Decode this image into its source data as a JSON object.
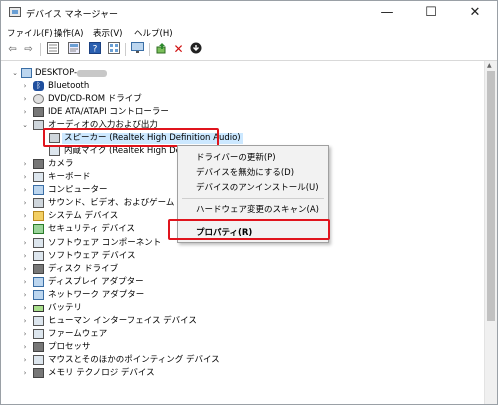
{
  "window": {
    "title": "デバイス マネージャー",
    "controls": {
      "minimize": "—",
      "maximize": "☐",
      "close": "✕"
    }
  },
  "menubar": [
    "ファイル(F)",
    "操作(A)",
    "表示(V)",
    "ヘルプ(H)"
  ],
  "toolbar": [
    "back-icon",
    "forward-icon",
    "view-icon",
    "properties-icon",
    "help-icon",
    "details-icon",
    "monitor-icon",
    "update-driver-icon",
    "uninstall-icon",
    "download-icon"
  ],
  "tree": {
    "root": "DESKTOP-",
    "items": [
      {
        "label": "Bluetooth",
        "icon": "bluetooth-icon",
        "expander": "›"
      },
      {
        "label": "DVD/CD-ROM ドライブ",
        "icon": "disc-drive-icon",
        "expander": "›"
      },
      {
        "label": "IDE ATA/ATAPI コントローラー",
        "icon": "ide-controller-icon",
        "expander": "›"
      },
      {
        "label": "オーディオの入力および出力",
        "icon": "audio-icon",
        "expander": "⌄"
      },
      {
        "label": "スピーカー (Realtek High Definition Audio)",
        "icon": "speaker-icon",
        "expander": ""
      },
      {
        "label": "内蔵マイク (Realtek High Definition Audio)",
        "icon": "microphone-icon",
        "expander": ""
      },
      {
        "label": "カメラ",
        "icon": "camera-icon",
        "expander": "›"
      },
      {
        "label": "キーボード",
        "icon": "keyboard-icon",
        "expander": "›"
      },
      {
        "label": "コンピューター",
        "icon": "computer-icon",
        "expander": "›"
      },
      {
        "label": "サウンド、ビデオ、およびゲーム コントローラー",
        "icon": "sound-icon",
        "expander": "›"
      },
      {
        "label": "システム デバイス",
        "icon": "system-devices-icon",
        "expander": "›"
      },
      {
        "label": "セキュリティ デバイス",
        "icon": "security-device-icon",
        "expander": "›"
      },
      {
        "label": "ソフトウェア コンポーネント",
        "icon": "software-component-icon",
        "expander": "›"
      },
      {
        "label": "ソフトウェア デバイス",
        "icon": "software-device-icon",
        "expander": "›"
      },
      {
        "label": "ディスク ドライブ",
        "icon": "disk-drive-icon",
        "expander": "›"
      },
      {
        "label": "ディスプレイ アダプター",
        "icon": "display-adapter-icon",
        "expander": "›"
      },
      {
        "label": "ネットワーク アダプター",
        "icon": "network-adapter-icon",
        "expander": "›"
      },
      {
        "label": "バッテリ",
        "icon": "battery-icon",
        "expander": "›"
      },
      {
        "label": "ヒューマン インターフェイス デバイス",
        "icon": "hid-icon",
        "expander": "›"
      },
      {
        "label": "ファームウェア",
        "icon": "firmware-icon",
        "expander": "›"
      },
      {
        "label": "プロセッサ",
        "icon": "processor-icon",
        "expander": "›"
      },
      {
        "label": "マウスとそのほかのポインティング デバイス",
        "icon": "mouse-icon",
        "expander": "›"
      },
      {
        "label": "メモリ テクノロジ デバイス",
        "icon": "memory-tech-icon",
        "expander": "›"
      }
    ]
  },
  "context_menu": [
    "ドライバーの更新(P)",
    "デバイスを無効にする(D)",
    "デバイスのアンインストール(U)",
    "ハードウェア変更のスキャン(A)",
    "プロパティ(R)"
  ],
  "colors": {
    "highlight_border": "#e0141d",
    "selection_bg": "#cce8ff",
    "menu_bg": "#f2f2f2"
  }
}
